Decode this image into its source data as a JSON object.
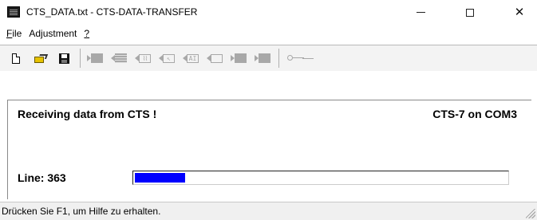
{
  "window": {
    "title": "CTS_DATA.txt - CTS-DATA-TRANSFER",
    "controls": {
      "minimize": "minimize-icon",
      "maximize": "maximize-icon",
      "close": "close-icon",
      "close_glyph": "✕"
    }
  },
  "menu": {
    "items": [
      {
        "accel": "F",
        "rest": "ile"
      },
      {
        "accel": "",
        "rest": "Adjustment"
      },
      {
        "accel": "?",
        "rest": ""
      }
    ]
  },
  "toolbar": {
    "buttons": [
      {
        "icon": "new-file-icon",
        "enabled": true
      },
      {
        "icon": "open-folder-icon",
        "enabled": true
      },
      {
        "icon": "save-icon",
        "enabled": true
      },
      {
        "icon": "send-block-icon",
        "enabled": false
      },
      {
        "icon": "receive-display-icon",
        "enabled": false
      },
      {
        "icon": "receive-signal-icon",
        "enabled": false
      },
      {
        "icon": "receive-cursor-icon",
        "enabled": false
      },
      {
        "icon": "receive-ai-icon",
        "enabled": false
      },
      {
        "icon": "receive-empty-icon",
        "enabled": false
      },
      {
        "icon": "transfer-block-icon",
        "enabled": false
      },
      {
        "icon": "transfer-block-2-icon",
        "enabled": false
      },
      {
        "icon": "key-icon",
        "enabled": false
      }
    ],
    "ai_text": "AI"
  },
  "content": {
    "status_message": "Receiving data from CTS !",
    "device": "CTS-7 on COM3",
    "line_label": "Line: 363",
    "progress_fraction": 0.135,
    "progress_color": "#0000ff"
  },
  "statusbar": {
    "text": "Drücken Sie F1, um Hilfe zu erhalten."
  }
}
